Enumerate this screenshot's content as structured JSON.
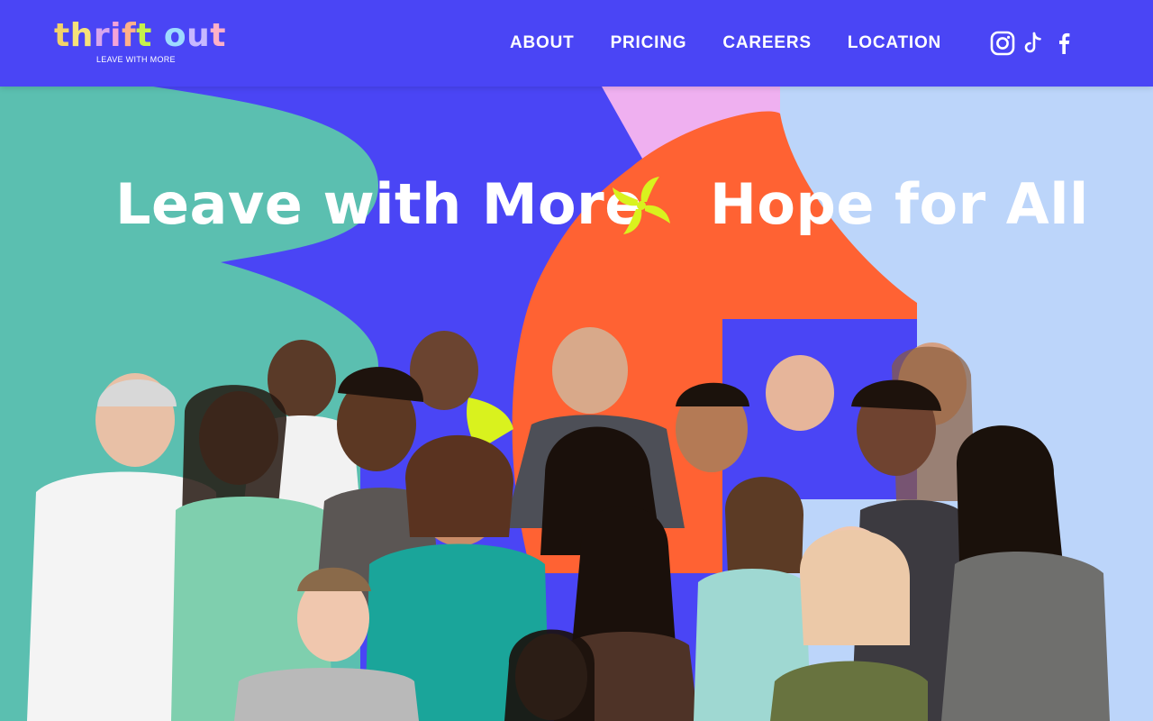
{
  "brand": {
    "name_letters": [
      {
        "ch": "t",
        "color": "#f2d26a"
      },
      {
        "ch": "h",
        "color": "#f6e27a"
      },
      {
        "ch": "r",
        "color": "#d7a6ee"
      },
      {
        "ch": "i",
        "color": "#f4a3d8"
      },
      {
        "ch": "f",
        "color": "#ffb08a"
      },
      {
        "ch": "t",
        "color": "#c6f04b"
      },
      {
        "ch": " ",
        "color": "#ffffff"
      },
      {
        "ch": "o",
        "color": "#9edbff"
      },
      {
        "ch": "u",
        "color": "#c7b8ff"
      },
      {
        "ch": "t",
        "color": "#ffb0c8"
      }
    ],
    "tagline": "LEAVE WITH MORE"
  },
  "nav": {
    "items": [
      "ABOUT",
      "PRICING",
      "CAREERS",
      "LOCATION"
    ]
  },
  "social": {
    "icons": [
      "instagram-icon",
      "tiktok-icon",
      "facebook-icon"
    ]
  },
  "hero": {
    "headline_left": "Leave with More",
    "headline_right": "Hope for All",
    "photo_subject": "group of smiling people"
  },
  "colors": {
    "header_bg": "#4a45f5",
    "teal": "#5bbfb0",
    "blue": "#4a45f5",
    "orange": "#ff6233",
    "lavender": "#bcd5fa",
    "pink": "#efb0f0",
    "lime": "#d9f21e"
  }
}
